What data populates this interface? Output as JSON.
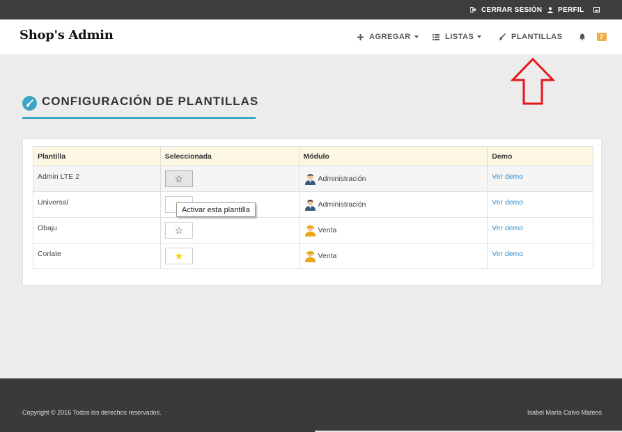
{
  "topbar": {
    "logout_label": "CERRAR SESIÓN",
    "profile_label": "PERFIL"
  },
  "navbar": {
    "brand": "Shop's Admin",
    "add_label": "AGREGAR",
    "lists_label": "LISTAS",
    "templates_label": "PLANTILLAS",
    "notifications_count": "7"
  },
  "page": {
    "title": "CONFIGURACIÓN DE PLANTILLAS"
  },
  "table": {
    "headers": [
      "Plantilla",
      "Seleccionada",
      "Módulo",
      "Demo"
    ],
    "rows": [
      {
        "name": "Admin LTE 2",
        "selected": false,
        "module": "Administración",
        "module_icon": "admin-user-icon",
        "demo": "Ver demo"
      },
      {
        "name": "Universal",
        "selected": true,
        "module": "Administración",
        "module_icon": "admin-user-icon",
        "demo": "Ver demo"
      },
      {
        "name": "Obaju",
        "selected": false,
        "module": "Venta",
        "module_icon": "sales-user-icon",
        "demo": "Ver demo"
      },
      {
        "name": "Corlate",
        "selected": true,
        "module": "Venta",
        "module_icon": "sales-user-icon",
        "demo": "Ver demo"
      }
    ]
  },
  "tooltip": {
    "text": "Activar esta plantilla"
  },
  "footer": {
    "copyright": "Copyright © 2016 Todos los derechos reservados.",
    "author": "Isabel María Calvo Mateos"
  },
  "colors": {
    "accent": "#3ca5c4",
    "badge": "#f0ad4e",
    "star": "#f6d000",
    "link": "#3a8dc9",
    "arrow": "#e8141a"
  }
}
